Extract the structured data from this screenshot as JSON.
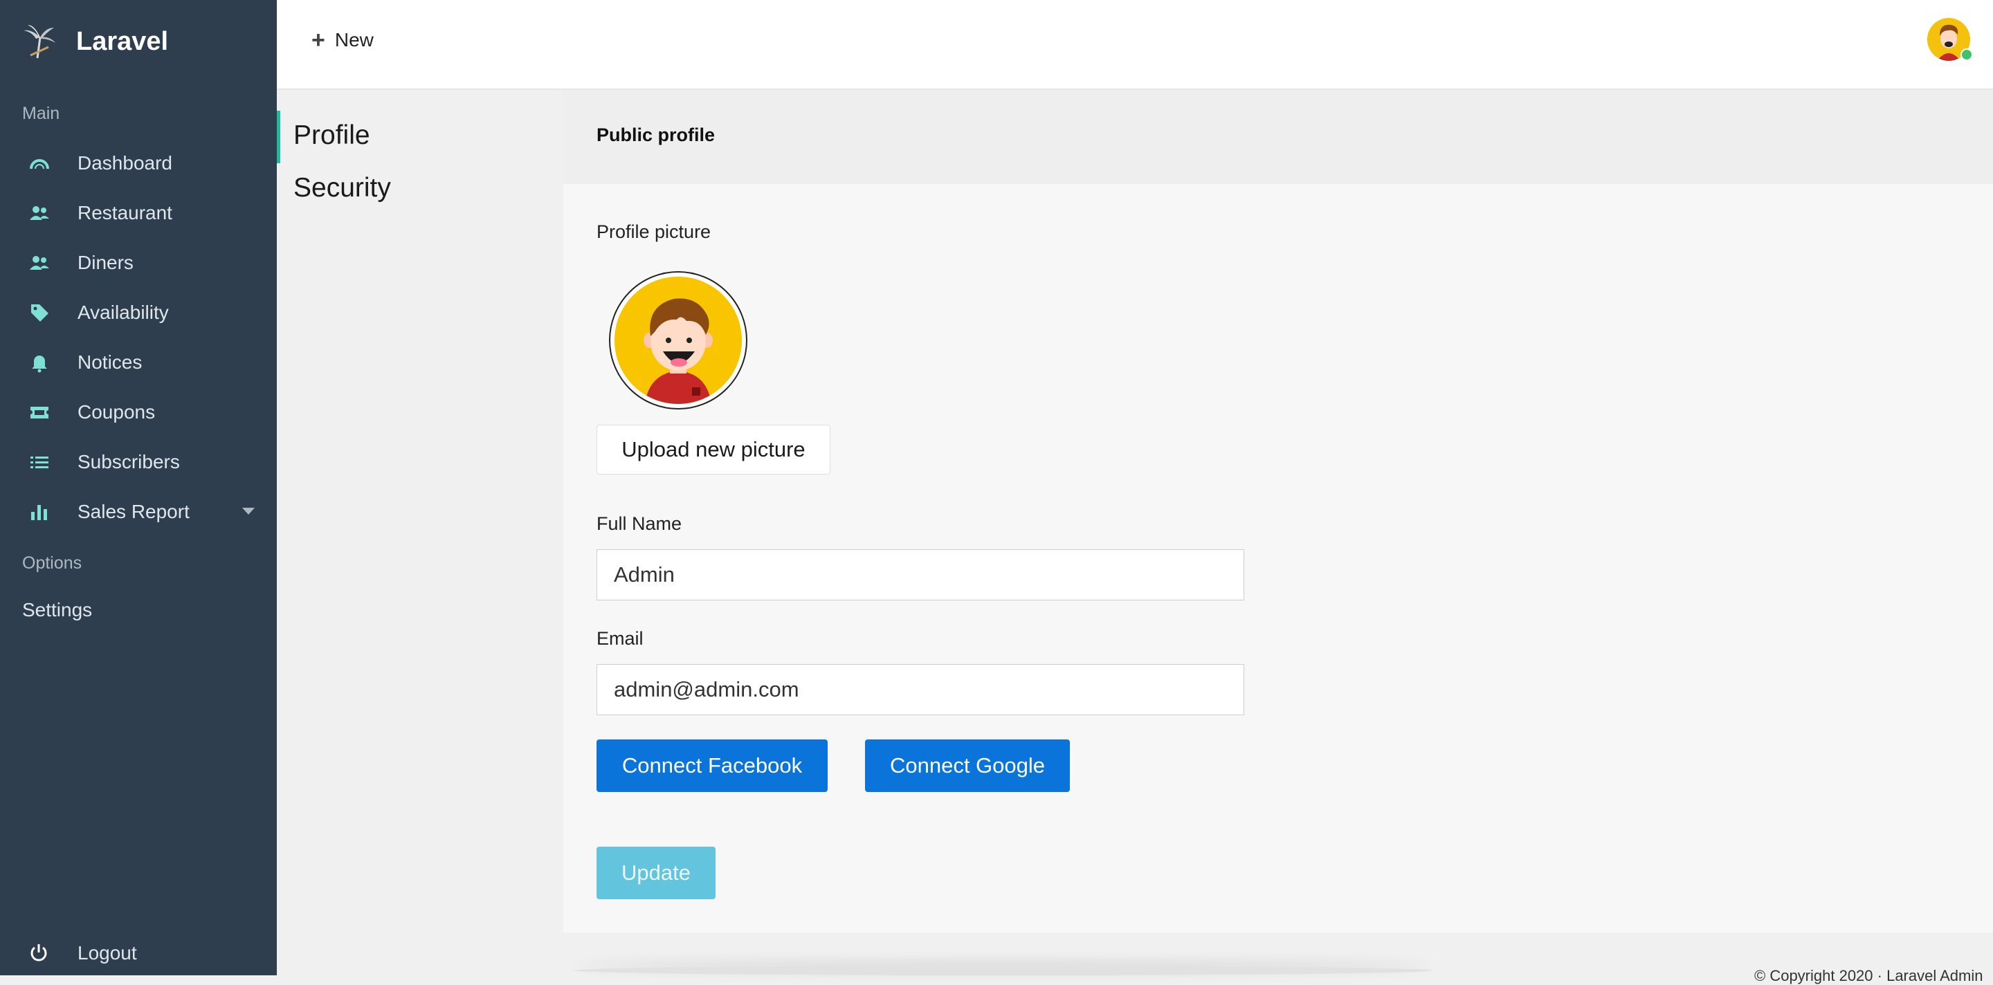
{
  "brand": {
    "name": "Laravel"
  },
  "sidebar": {
    "section_main": "Main",
    "section_options": "Options",
    "items": [
      {
        "label": "Dashboard",
        "icon": "gauge-icon"
      },
      {
        "label": "Restaurant",
        "icon": "users-icon"
      },
      {
        "label": "Diners",
        "icon": "users-icon"
      },
      {
        "label": "Availability",
        "icon": "tag-icon"
      },
      {
        "label": "Notices",
        "icon": "bell-icon"
      },
      {
        "label": "Coupons",
        "icon": "ticket-icon"
      },
      {
        "label": "Subscribers",
        "icon": "list-icon"
      },
      {
        "label": "Sales Report",
        "icon": "bar-chart-icon"
      }
    ],
    "settings_label": "Settings",
    "logout_label": "Logout"
  },
  "topbar": {
    "new_label": "New"
  },
  "subnav": {
    "items": [
      "Profile",
      "Security"
    ],
    "active": "Profile"
  },
  "panel": {
    "title": "Public profile",
    "picture_label": "Profile picture",
    "upload_label": "Upload new picture",
    "full_name_label": "Full Name",
    "full_name_value": "Admin",
    "email_label": "Email",
    "email_value": "admin@admin.com",
    "connect_facebook": "Connect Facebook",
    "connect_google": "Connect Google",
    "update_label": "Update"
  },
  "footer": {
    "copyright": "© Copyright 2020 · Laravel Admin"
  },
  "colors": {
    "sidebar_bg": "#2f3e4e",
    "accent_teal": "#1fb99d",
    "icon_teal": "#7fe0d6",
    "primary_blue": "#0a74da",
    "update_disabled": "#63c5dd",
    "avatar_yellow": "#f9c400"
  }
}
